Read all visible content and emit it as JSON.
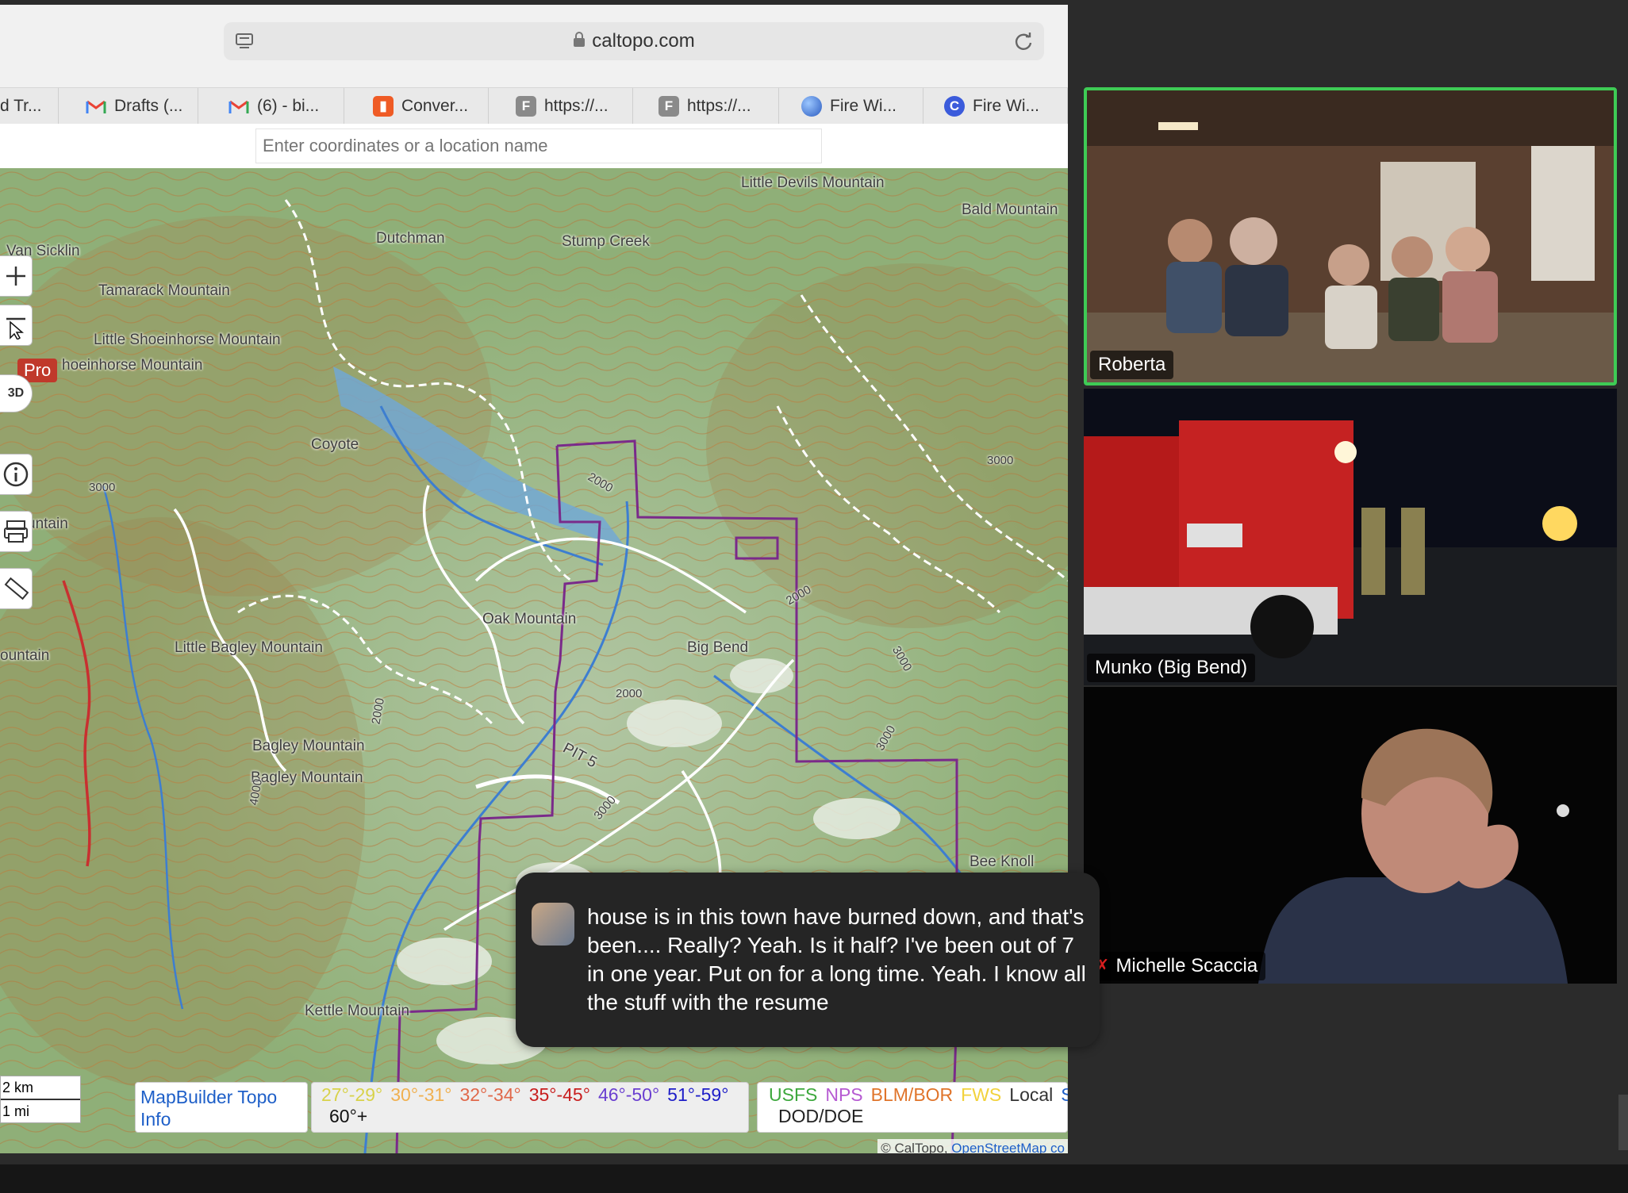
{
  "browser": {
    "url": "caltopo.com",
    "tabs": [
      {
        "label": "d Tr...",
        "icon": "blank-icon",
        "color": "#e9e9e9"
      },
      {
        "label": "Drafts (...",
        "icon": "gmail-icon",
        "color": "#ea4335"
      },
      {
        "label": "(6) - bi...",
        "icon": "gmail-icon",
        "color": "#ea4335"
      },
      {
        "label": "Conver...",
        "icon": "bookmark-icon",
        "color": "#ef5b25"
      },
      {
        "label": "https://...",
        "icon": "f-icon",
        "color": "#8a8a8a"
      },
      {
        "label": "https://...",
        "icon": "f-icon",
        "color": "#8a8a8a"
      },
      {
        "label": "Fire Wi...",
        "icon": "globe-icon",
        "color": "#3b7ddd"
      },
      {
        "label": "Fire Wi...",
        "icon": "c-icon",
        "color": "#3b5bdb"
      }
    ]
  },
  "map": {
    "search_placeholder": "Enter coordinates or a location name",
    "pro_label": "Pro",
    "three_d_label": "3D",
    "place_labels": [
      "Little Devils Mountain",
      "Bald Mountain",
      "Dutchman",
      "Stump Creek",
      "Van Sicklin",
      "Tamarack Mountain",
      "Little Shoeinhorse Mountain",
      "hoeinhorse Mountain",
      "Coyote",
      "Oak Mountain",
      "Big Bend",
      "Little Bagley Mountain",
      "Bagley Mountain",
      "Bagley Mountain",
      "Kettle Mountain",
      "Bee Knoll",
      "untain",
      "ountain",
      "PIT 5"
    ],
    "contour_labels": [
      "2000",
      "3000",
      "3000",
      "2000",
      "2000",
      "3000",
      "3000",
      "4000",
      "2000",
      "3000"
    ],
    "scale": {
      "km": "2 km",
      "mi": "1 mi"
    },
    "legend": {
      "mapbuilder": "MapBuilder Topo",
      "info": "Info",
      "temps": [
        {
          "label": "27°-29°",
          "color": "#d8d24a"
        },
        {
          "label": "30°-31°",
          "color": "#f0b050"
        },
        {
          "label": "32°-34°",
          "color": "#e0684a"
        },
        {
          "label": "35°-45°",
          "color": "#c81e1e"
        },
        {
          "label": "46°-50°",
          "color": "#6a3fd0"
        },
        {
          "label": "51°-59°",
          "color": "#1e1ec8"
        },
        {
          "label": "60°+",
          "color": "#111111"
        }
      ],
      "land": [
        {
          "label": "USFS",
          "color": "#3da83d"
        },
        {
          "label": "NPS",
          "color": "#b65ad2"
        },
        {
          "label": "BLM/BOR",
          "color": "#e0742a"
        },
        {
          "label": "FWS",
          "color": "#f2d23c"
        },
        {
          "label": "Local",
          "color": "#333333"
        },
        {
          "label": "S",
          "color": "#1e5fc8"
        },
        {
          "label": "DOD/DOE",
          "color": "#222222"
        }
      ]
    },
    "attribution_prefix": "© CalTopo,",
    "attribution_link": "OpenStreetMap co"
  },
  "caption": {
    "text": "house is in this town have burned down, and that's been.... Really? Yeah. Is it half? I've been out of 7 in one year. Put on for a long time. Yeah. I know all the stuff with the resume"
  },
  "participants": [
    {
      "name": "Roberta",
      "active_speaker": true,
      "muted": false
    },
    {
      "name": "Munko (Big Bend)",
      "active_speaker": false,
      "muted": false
    },
    {
      "name": "Michelle Scaccia",
      "active_speaker": false,
      "muted": true
    }
  ],
  "colors": {
    "active_speaker_border": "#3ecb55",
    "mute_icon": "#e22222",
    "park_boundary": "#7a2a8a"
  }
}
